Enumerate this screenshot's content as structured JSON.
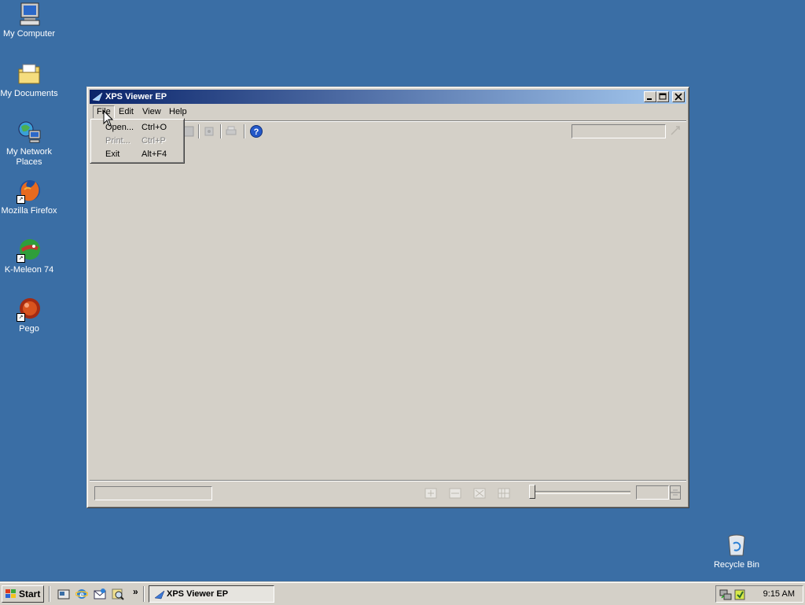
{
  "desktop": {
    "icons": [
      {
        "label": "My Computer"
      },
      {
        "label": "My Documents"
      },
      {
        "label": "My Network Places"
      },
      {
        "label": "Mozilla Firefox"
      },
      {
        "label": "K-Meleon 74"
      },
      {
        "label": "Pego"
      },
      {
        "label": "Recycle Bin"
      }
    ]
  },
  "window": {
    "title": "XPS Viewer EP",
    "menu": [
      "File",
      "Edit",
      "View",
      "Help"
    ],
    "file_menu": [
      {
        "label": "Open...",
        "accel": "Ctrl+O",
        "enabled": true
      },
      {
        "label": "Print...",
        "accel": "Ctrl+P",
        "enabled": false
      },
      {
        "label": "Exit",
        "accel": "Alt+F4",
        "enabled": true
      }
    ],
    "help_icon": "?"
  },
  "taskbar": {
    "start_label": "Start",
    "chevron": "»",
    "task_label": "XPS Viewer EP",
    "clock": "9:15 AM"
  },
  "colors": {
    "desktop": "#3a6ea5",
    "titlebar_start": "#0a246a",
    "titlebar_end": "#a6caf0",
    "face": "#d4d0c8"
  }
}
